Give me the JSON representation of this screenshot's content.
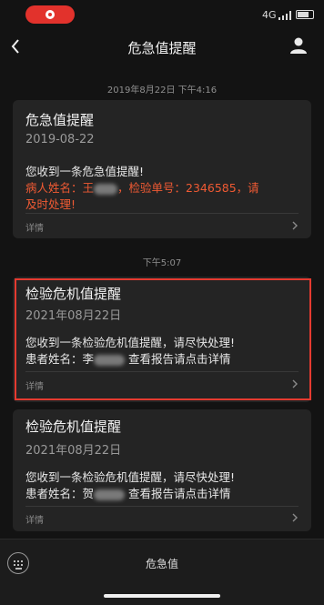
{
  "status_bar": {
    "network": "4G"
  },
  "nav": {
    "title": "危急值提醒"
  },
  "messages": [
    {
      "time": "2019年8月22日 下午4:16",
      "title": "危急值提醒",
      "date": "2019-08-22",
      "line1": "您收到一条危急值提醒!",
      "line2_prefix": "病人姓名：王",
      "line2_suffix": "，检验单号：2346585，请",
      "line3": "及时处理!",
      "detail": "详情"
    },
    {
      "time": "下午5:07",
      "title": "检验危机值提醒",
      "date": "2021年08月22日",
      "line1": "您收到一条检验危机值提醒，请尽快处理!",
      "line2_prefix": "患者姓名：李",
      "line2_suffix": "查看报告请点击详情",
      "detail": "详情"
    },
    {
      "title": "检验危机值提醒",
      "date": "2021年08月22日",
      "line1": "您收到一条检验危机值提醒，请尽快处理!",
      "line2_prefix": "患者姓名：贺",
      "line2_suffix": "查看报告请点击详情",
      "detail": "详情"
    }
  ],
  "bottom": {
    "menu_label": "危急值"
  },
  "colors": {
    "background": "#131313",
    "card": "#242424",
    "alert_red": "#f05a33",
    "highlight": "#e53a30",
    "record": "#e2322c"
  },
  "icons": [
    "record-indicator-icon",
    "back-arrow-icon",
    "profile-icon",
    "chevron-right-icon",
    "keyboard-icon"
  ]
}
